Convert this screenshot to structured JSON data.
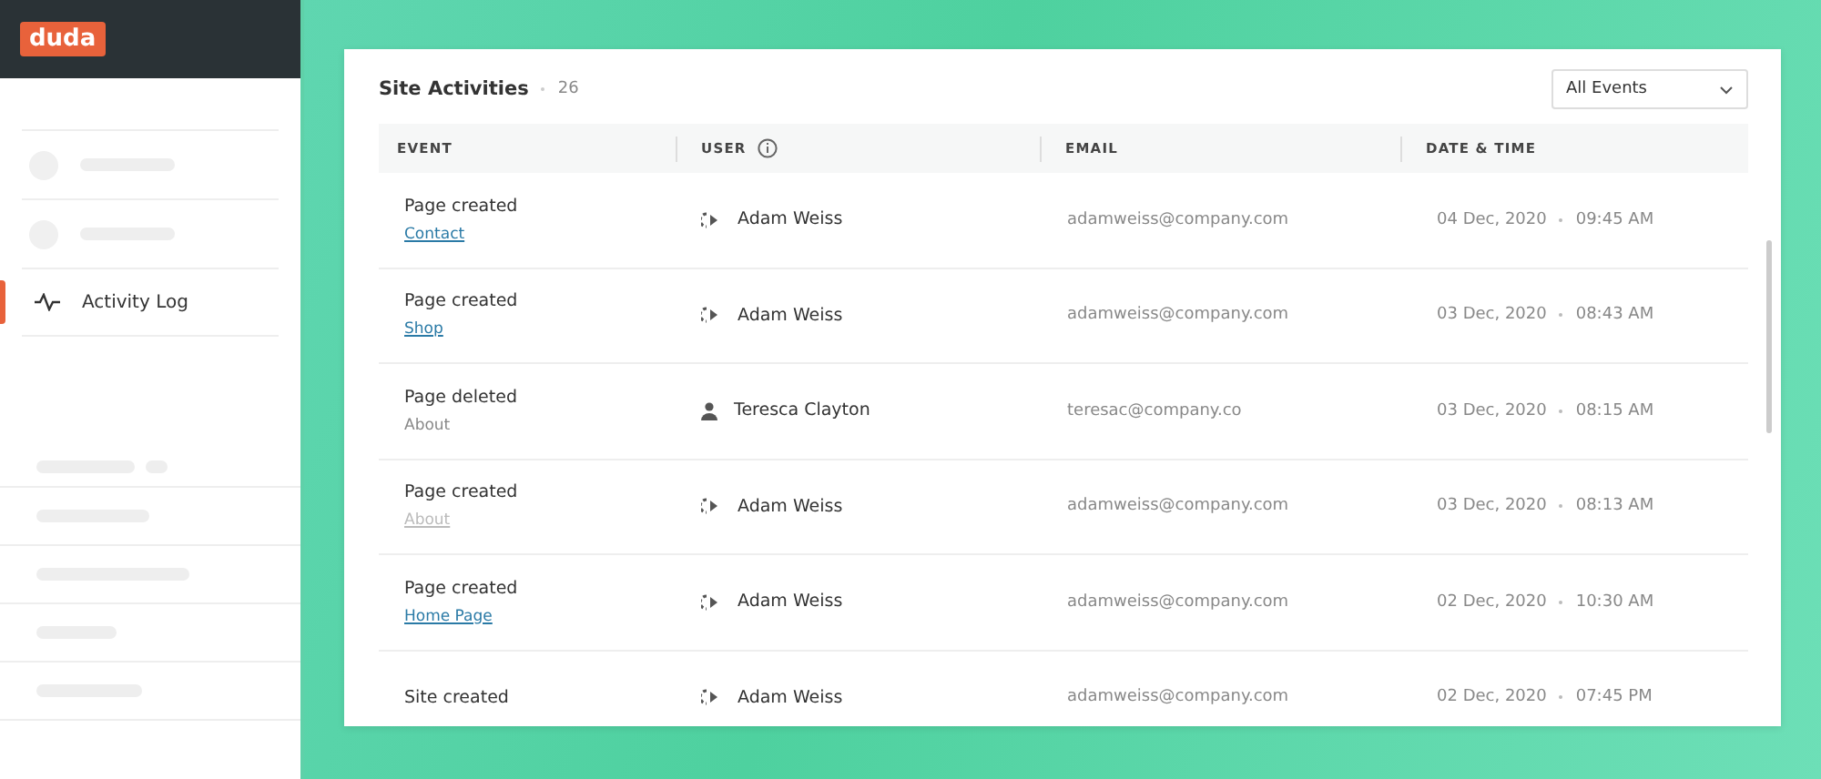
{
  "logo": "duda",
  "sidebar": {
    "items": [
      {
        "label": "Activity Log",
        "selected": true
      }
    ]
  },
  "panel": {
    "title": "Site Activities",
    "count": "26",
    "filter": {
      "value": "All Events"
    }
  },
  "table": {
    "columns": [
      {
        "label": "EVENT",
        "info": false
      },
      {
        "label": "USER",
        "info": true
      },
      {
        "label": "EMAIL",
        "info": false
      },
      {
        "label": "DATE & TIME",
        "info": false
      }
    ],
    "rows": [
      {
        "event": "Page created",
        "page": {
          "text": "Contact",
          "kind": "link"
        },
        "user": {
          "name": "Adam Weiss",
          "kind": "import"
        },
        "email": "adamweiss@company.com",
        "date": "04 Dec, 2020",
        "time": "09:45 AM"
      },
      {
        "event": "Page created",
        "page": {
          "text": "Shop",
          "kind": "link"
        },
        "user": {
          "name": "Adam Weiss",
          "kind": "import"
        },
        "email": "adamweiss@company.com",
        "date": "03 Dec, 2020",
        "time": "08:43 AM"
      },
      {
        "event": "Page deleted",
        "page": {
          "text": "About",
          "kind": "plain"
        },
        "user": {
          "name": "Teresca Clayton",
          "kind": "person"
        },
        "email": "teresac@company.co",
        "date": "03 Dec, 2020",
        "time": "08:15 AM"
      },
      {
        "event": "Page created",
        "page": {
          "text": "About",
          "kind": "dimmed-link"
        },
        "user": {
          "name": "Adam Weiss",
          "kind": "import"
        },
        "email": "adamweiss@company.com",
        "date": "03 Dec, 2020",
        "time": "08:13 AM"
      },
      {
        "event": "Page created",
        "page": {
          "text": "Home Page",
          "kind": "link"
        },
        "user": {
          "name": "Adam Weiss",
          "kind": "import"
        },
        "email": "adamweiss@company.com",
        "date": "02 Dec, 2020",
        "time": "10:30 AM"
      },
      {
        "event": "Site created",
        "user": {
          "name": "Adam Weiss",
          "kind": "import"
        },
        "email": "adamweiss@company.com",
        "date": "02 Dec, 2020",
        "time": "07:45 PM"
      }
    ]
  }
}
